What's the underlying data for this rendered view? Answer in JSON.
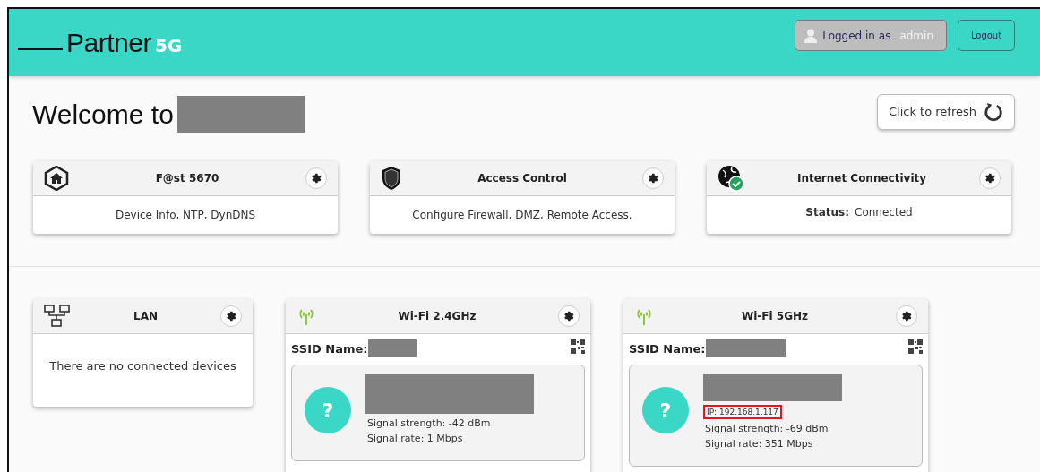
{
  "header": {
    "logo": {
      "name": "Partner",
      "badge": "5G"
    },
    "user_badge": {
      "label": "Logged in as",
      "user": "admin"
    },
    "logout": "Logout"
  },
  "welcome": {
    "title": "Welcome to",
    "name_redacted": true
  },
  "refresh": "Click to refresh",
  "top_cards": [
    {
      "kind": "device",
      "title": "F@st 5670",
      "body": "Device Info, NTP, DynDNS"
    },
    {
      "kind": "security",
      "title": "Access Control",
      "body": "Configure Firewall, DMZ, Remote Access."
    },
    {
      "kind": "internet",
      "title": "Internet Connectivity",
      "status_label": "Status:",
      "status_value": "Connected"
    }
  ],
  "lan": {
    "title": "LAN",
    "message": "There are no connected devices"
  },
  "wifi_cards": [
    {
      "title": "Wi-Fi 2.4GHz",
      "ssid_label": "SSID Name:",
      "client": {
        "strength": "Signal strength: -42 dBm",
        "rate": "Signal rate: 1 Mbps",
        "avatar": "?"
      }
    },
    {
      "title": "Wi-Fi 5GHz",
      "ssid_label": "SSID Name:",
      "client": {
        "ip": "IP: 192.168.1.117",
        "highlighted": true,
        "strength": "Signal strength: -69 dBm",
        "rate": "Signal rate: 351 Mbps",
        "avatar": "?"
      }
    }
  ]
}
